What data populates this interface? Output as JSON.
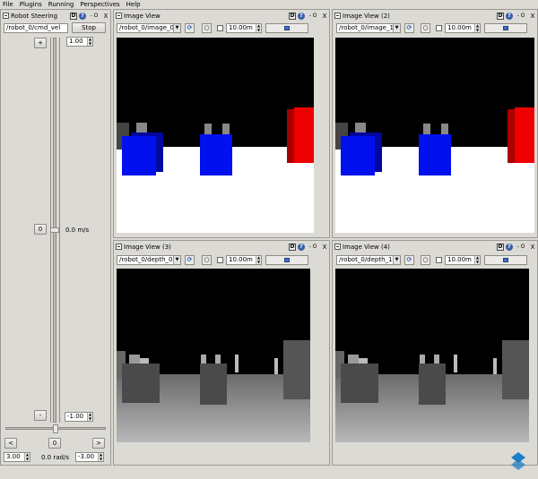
{
  "menu": [
    "File",
    "Plugins",
    "Running",
    "Perspectives",
    "Help"
  ],
  "steering": {
    "title": "Robot Steering",
    "topic": "/robot_0/cmd_vel",
    "stop_label": "Stop",
    "plus_label": "+",
    "minus_label": "-",
    "zero_label": "0",
    "left_label": "<",
    "right_label": ">",
    "linear_max": "1.00",
    "linear_min": "-1.00",
    "linear_value": "0.0 m/s",
    "angular_max": "3.00",
    "angular_min": "-3.00",
    "angular_value": "0.0 rad/s"
  },
  "titlebar_buttons": {
    "d": "D",
    "help": "?",
    "min": "- O",
    "close": "X"
  },
  "views": [
    {
      "title": "Image View",
      "topic": "/robot_0/image_0",
      "distance": "10.00m"
    },
    {
      "title": "Image View (2)",
      "topic": "/robot_0/image_1",
      "distance": "10.00m"
    },
    {
      "title": "Image View (3)",
      "topic": "/robot_0/depth_0",
      "distance": "10.00m"
    },
    {
      "title": "Image View (4)",
      "topic": "/robot_0/depth_1",
      "distance": "10.00m"
    }
  ],
  "icons": {
    "refresh": "refresh-icon",
    "zoom": "zoom-icon",
    "save": "save-icon",
    "dropdown": "chevron-down-icon"
  },
  "colors": {
    "rgb_box_blue": "#0010ee",
    "rgb_box_red": "#ee0000",
    "depth_floor": "#9c9c9c"
  }
}
